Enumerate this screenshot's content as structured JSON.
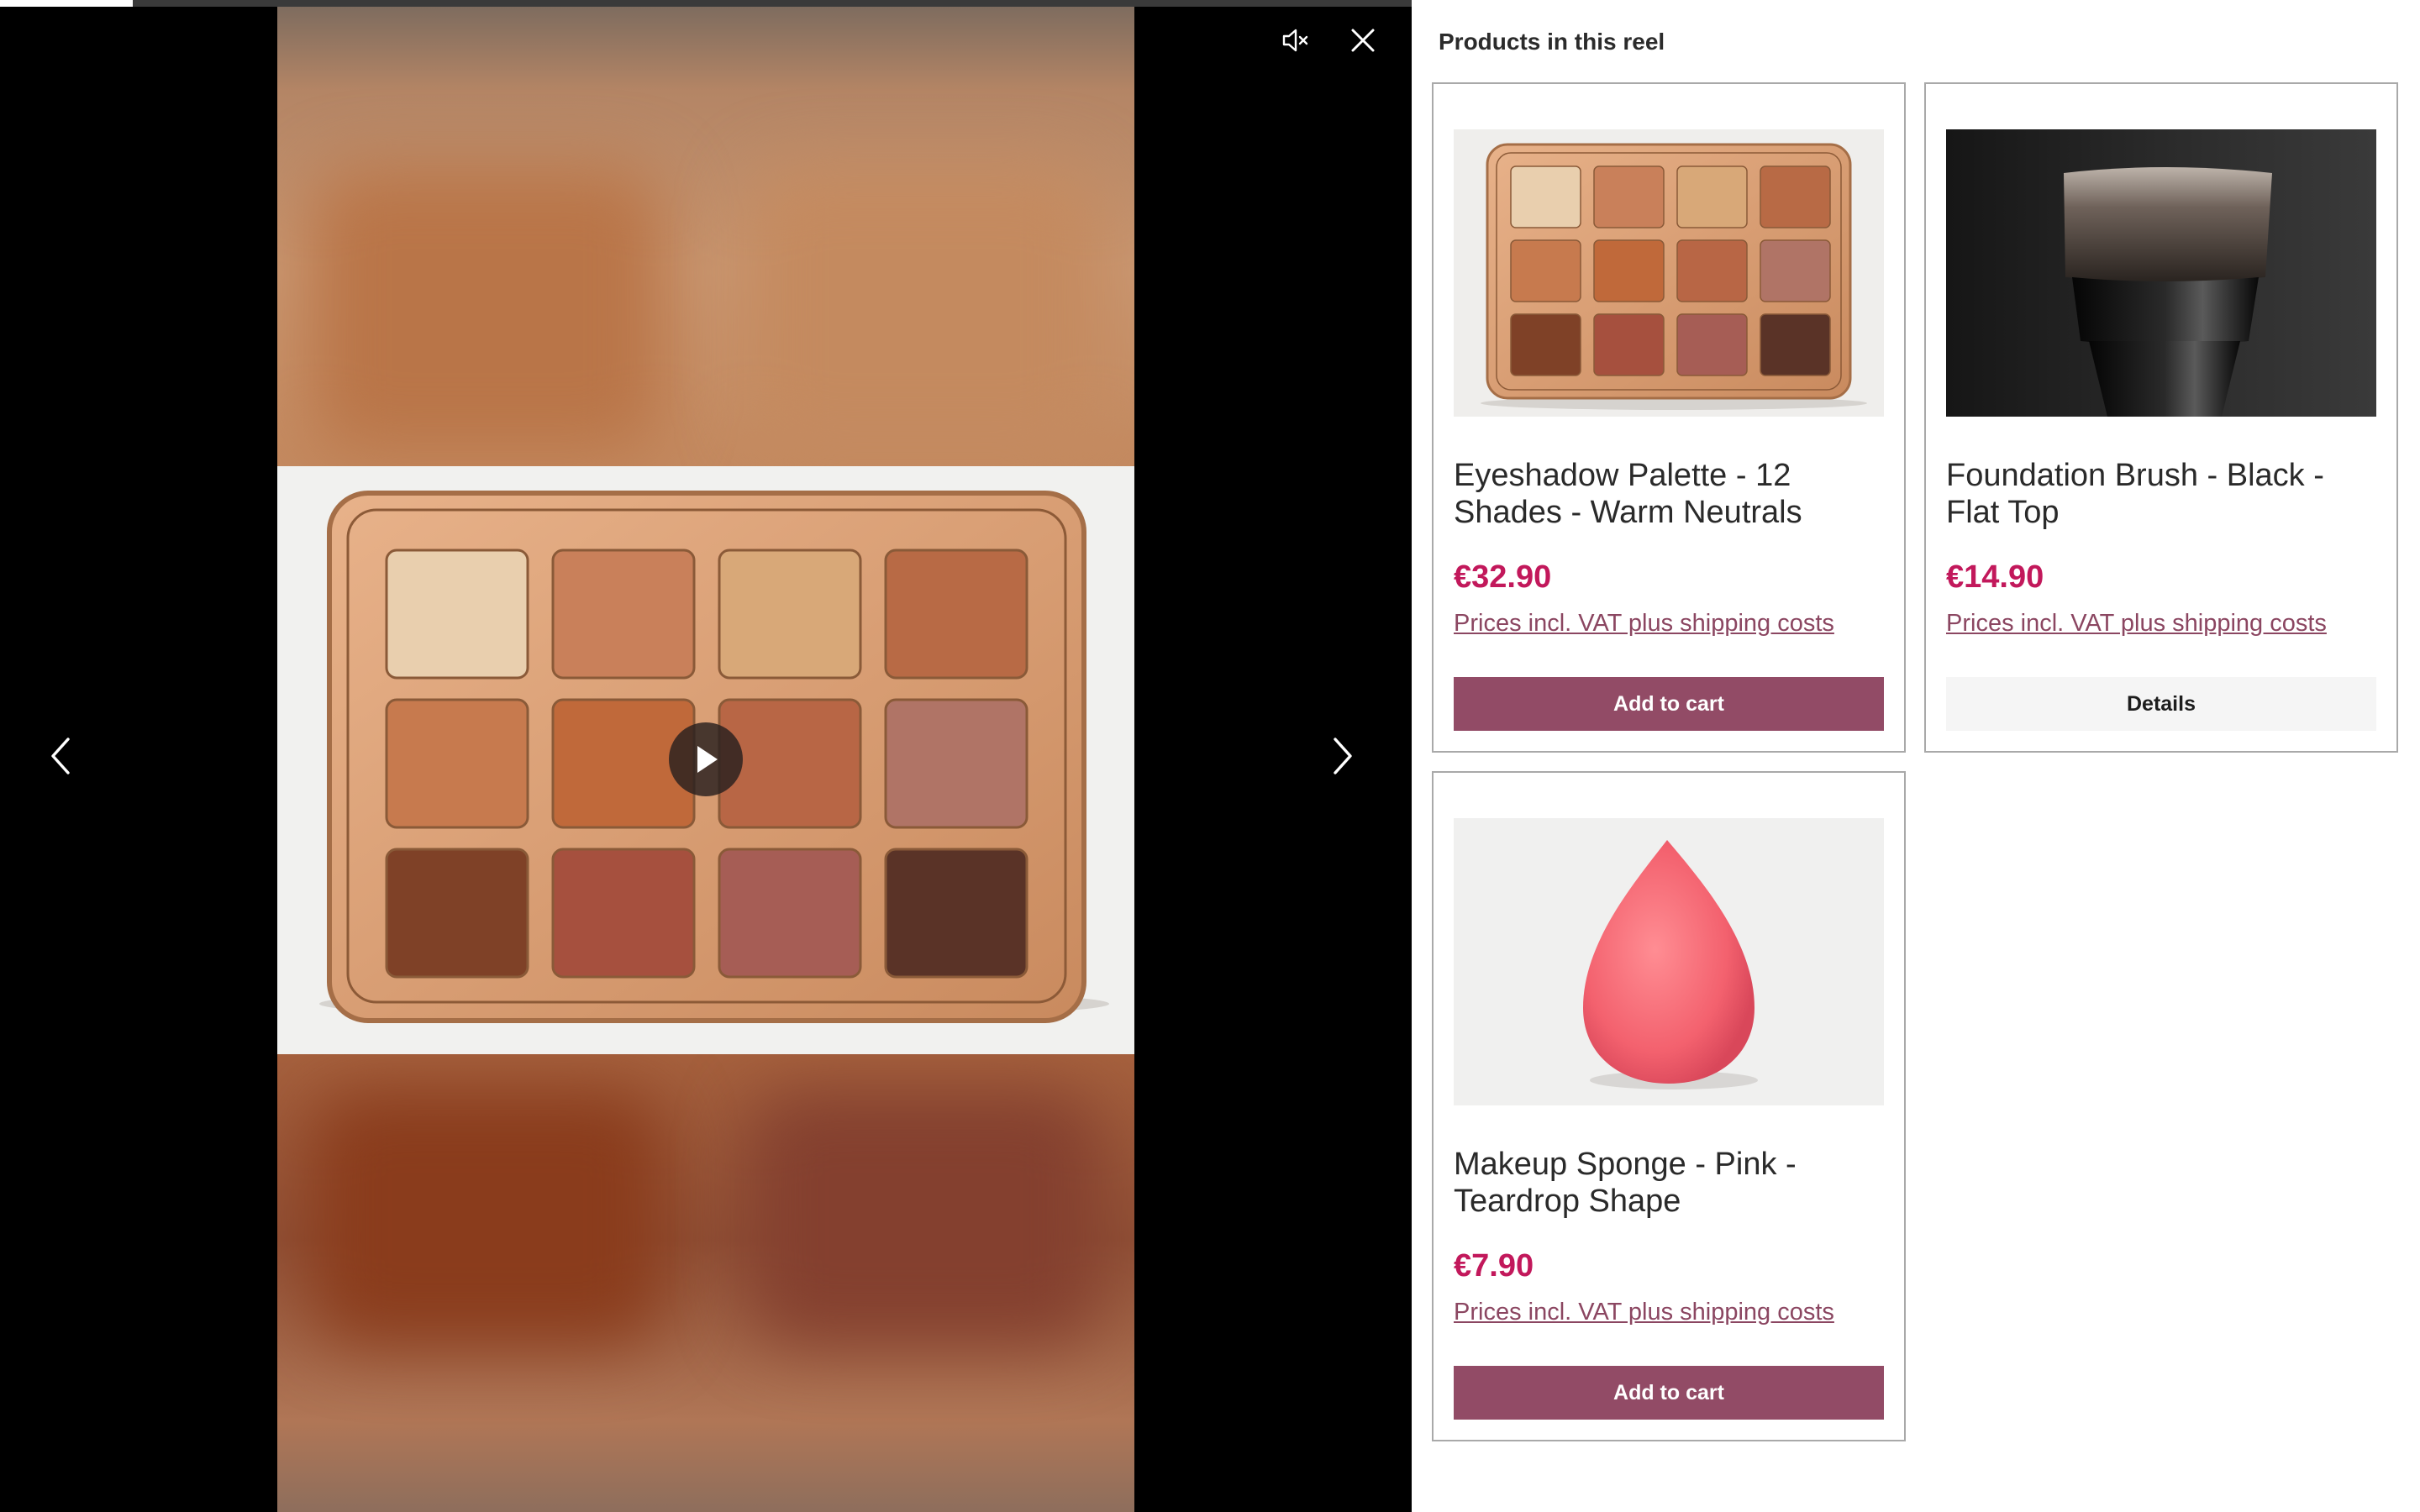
{
  "video": {
    "progress_fraction": 0.094,
    "mute_icon": "speaker-muted-icon",
    "close_icon": "close-icon",
    "prev_icon": "chevron-left-icon",
    "next_icon": "chevron-right-icon",
    "play_icon": "play-icon"
  },
  "panel": {
    "title": "Products in this reel"
  },
  "products": [
    {
      "name": "Eyeshadow Palette - 12 Shades - Warm Neutrals",
      "price": "€32.90",
      "vat_note": "Prices incl. VAT plus shipping costs",
      "action_label": "Add to cart"
    },
    {
      "name": "Foundation Brush - Black - Flat Top",
      "price": "€14.90",
      "vat_note": "Prices incl. VAT plus shipping costs",
      "action_label": "Details"
    },
    {
      "name": "Makeup Sponge - Pink - Teardrop Shape",
      "price": "€7.90",
      "vat_note": "Prices incl. VAT plus shipping costs",
      "action_label": "Add to cart"
    }
  ],
  "colors": {
    "price": "#c2185b",
    "primary_button": "#924b66",
    "vat_link": "#8b4661"
  }
}
